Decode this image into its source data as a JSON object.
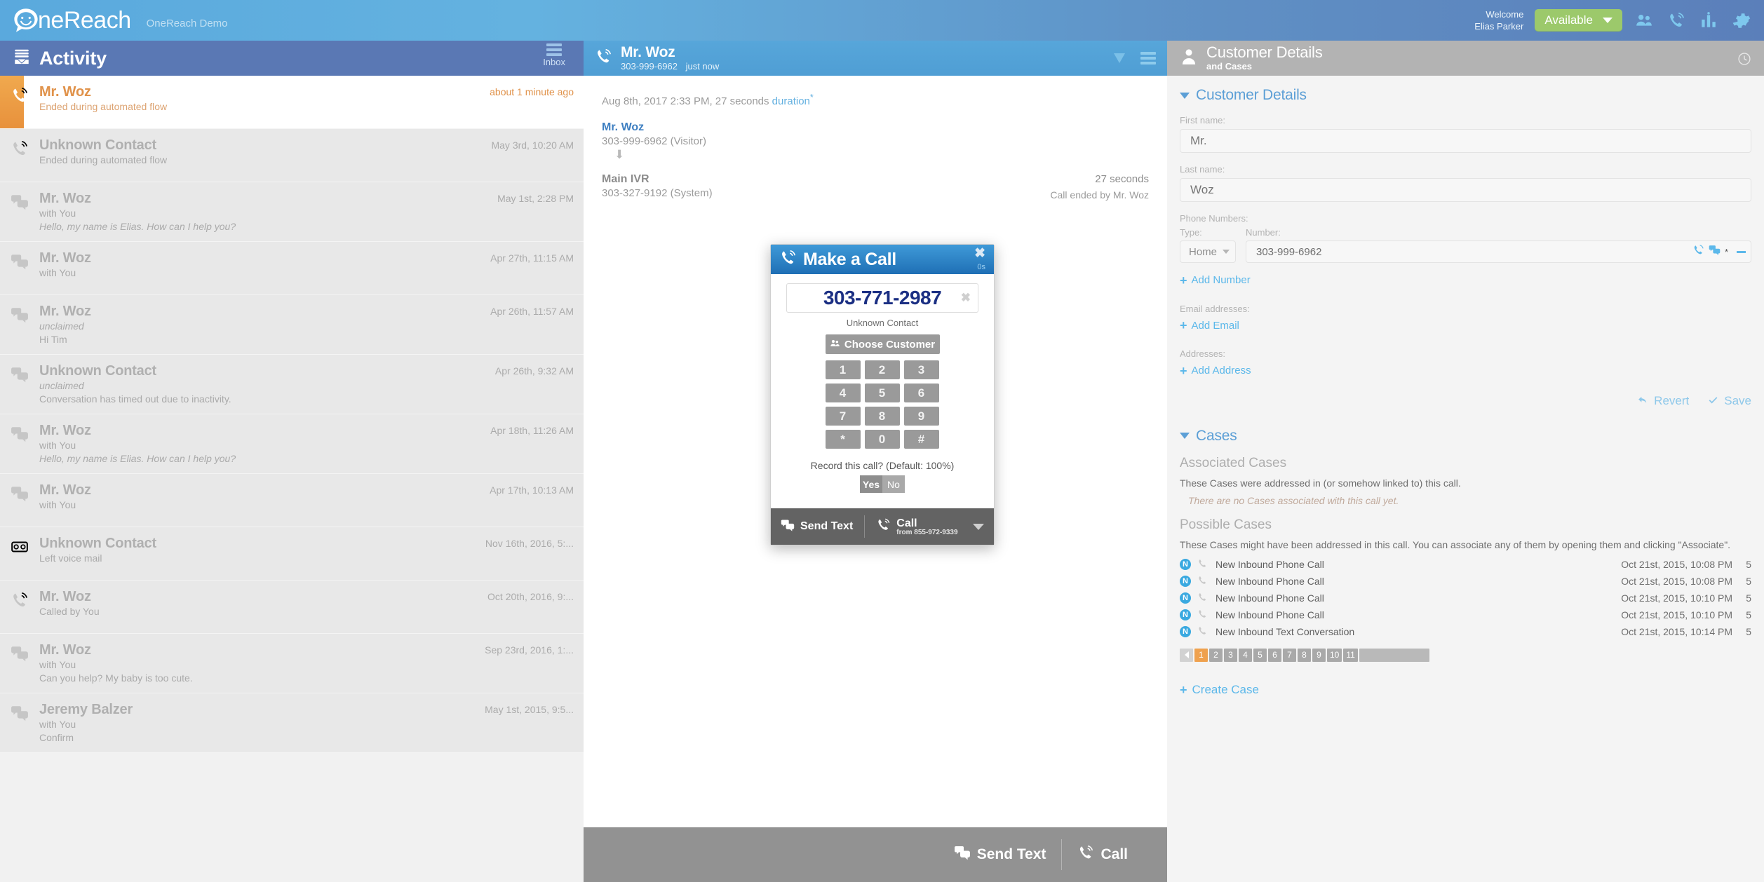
{
  "topbar": {
    "brand": "neReach",
    "demo_label": "OneReach Demo",
    "welcome_line1": "Welcome",
    "welcome_line2": "Elias Parker",
    "status": "Available",
    "icons": [
      "people-icon",
      "phone-icon",
      "chart-icon",
      "gear-icon"
    ],
    "accent": "#9cc96b"
  },
  "left": {
    "title": "Activity",
    "inbox_label": "Inbox",
    "items": [
      {
        "icon": "phone-icon",
        "name": "Mr. Woz",
        "sub1": "Ended during automated flow",
        "sub2": "",
        "time": "about 1 minute ago",
        "active": true
      },
      {
        "icon": "phone-icon",
        "name": "Unknown Contact",
        "sub1": "Ended during automated flow",
        "sub2": "",
        "time": "May 3rd, 10:20 AM",
        "active": false
      },
      {
        "icon": "chat-icon",
        "name": "Mr. Woz",
        "sub1": "with You",
        "sub2": "Hello, my name is Elias. How can I help you?",
        "time": "May 1st, 2:28 PM",
        "active": false
      },
      {
        "icon": "chat-icon",
        "name": "Mr. Woz",
        "sub1": "with You",
        "sub2": "",
        "time": "Apr 27th, 11:15 AM",
        "active": false
      },
      {
        "icon": "chat-icon",
        "name": "Mr. Woz",
        "sub1": "unclaimed",
        "sub2": "Hi Tim",
        "time": "Apr 26th, 11:57 AM",
        "active": false
      },
      {
        "icon": "chat-icon",
        "name": "Unknown Contact",
        "sub1": "unclaimed",
        "sub2": "Conversation has timed out due to inactivity.",
        "time": "Apr 26th, 9:32 AM",
        "active": false
      },
      {
        "icon": "chat-icon",
        "name": "Mr. Woz",
        "sub1": "with You",
        "sub2": "Hello, my name is Elias. How can I help you?",
        "time": "Apr 18th, 11:26 AM",
        "active": false
      },
      {
        "icon": "chat-icon",
        "name": "Mr. Woz",
        "sub1": "with You",
        "sub2": "",
        "time": "Apr 17th, 10:13 AM",
        "active": false
      },
      {
        "icon": "voicemail-icon",
        "name": "Unknown Contact",
        "sub1": "Left voice mail",
        "sub2": "",
        "time": "Nov 16th, 2016, 5:...",
        "active": false
      },
      {
        "icon": "phone-icon",
        "name": "Mr. Woz",
        "sub1": "Called by You",
        "sub2": "",
        "time": "Oct 20th, 2016, 9:...",
        "active": false
      },
      {
        "icon": "chat-icon",
        "name": "Mr. Woz",
        "sub1": "with You",
        "sub2": "Can you help? My baby is too cute.",
        "time": "Sep 23rd, 2016, 1:...",
        "active": false
      },
      {
        "icon": "chat-icon",
        "name": "Jeremy Balzer",
        "sub1": "with You",
        "sub2": "Confirm",
        "time": "May 1st, 2015, 9:5...",
        "active": false
      }
    ]
  },
  "center": {
    "header": {
      "name": "Mr. Woz",
      "phone": "303-999-6962",
      "when": "just now"
    },
    "call_meta_prefix": "Aug 8th, 2017 2:33 PM, 27 seconds ",
    "call_meta_link": "duration",
    "legs": [
      {
        "name": "Mr. Woz",
        "number": "303-999-6962 (Visitor)",
        "system": false
      },
      {
        "name": "Main IVR",
        "number": "303-327-9192 (System)",
        "system": true
      }
    ],
    "duration": "27 seconds",
    "ended_by": "Call ended by Mr. Woz",
    "footer": {
      "send_text": "Send Text",
      "call": "Call"
    }
  },
  "modal": {
    "title": "Make a Call",
    "timer": "0s",
    "number": "303-771-2987",
    "contact_label": "Unknown Contact",
    "choose_customer": "Choose Customer",
    "keys": [
      "1",
      "2",
      "3",
      "4",
      "5",
      "6",
      "7",
      "8",
      "9",
      "*",
      "0",
      "#"
    ],
    "record_question": "Record this call? (Default: 100%)",
    "yes": "Yes",
    "no": "No",
    "send_text": "Send Text",
    "call": "Call",
    "call_from": "from 855-972-9339"
  },
  "right": {
    "header_title": "Customer Details",
    "header_sub": "and Cases",
    "section_customer": "Customer Details",
    "first_name_label": "First name:",
    "first_name_value": "Mr.",
    "last_name_label": "Last name:",
    "last_name_value": "Woz",
    "phone_numbers_label": "Phone Numbers:",
    "type_label": "Type:",
    "number_label": "Number:",
    "phone_type": "Home",
    "phone_value": "303-999-6962",
    "add_number": "Add Number",
    "email_label": "Email addresses:",
    "add_email": "Add Email",
    "addresses_label": "Addresses:",
    "add_address": "Add Address",
    "revert": "Revert",
    "save": "Save",
    "section_cases": "Cases",
    "associated_title": "Associated Cases",
    "associated_desc": "These Cases were addressed in (or somehow linked to) this call.",
    "associated_empty": "There are no Cases associated with this call yet.",
    "possible_title": "Possible Cases",
    "possible_desc": "These Cases might have been addressed in this call. You can associate any of them by opening them and clicking \"Associate\".",
    "possible_cases": [
      {
        "badge": "N",
        "title": "New Inbound Phone Call",
        "time": "Oct 21st, 2015, 10:08 PM",
        "count": "5"
      },
      {
        "badge": "N",
        "title": "New Inbound Phone Call",
        "time": "Oct 21st, 2015, 10:08 PM",
        "count": "5"
      },
      {
        "badge": "N",
        "title": "New Inbound Phone Call",
        "time": "Oct 21st, 2015, 10:10 PM",
        "count": "5"
      },
      {
        "badge": "N",
        "title": "New Inbound Phone Call",
        "time": "Oct 21st, 2015, 10:10 PM",
        "count": "5"
      },
      {
        "badge": "N",
        "title": "New Inbound Text Conversation",
        "time": "Oct 21st, 2015, 10:14 PM",
        "count": "5"
      }
    ],
    "pages": [
      "1",
      "2",
      "3",
      "4",
      "5",
      "6",
      "7",
      "8",
      "9",
      "10",
      "11"
    ],
    "current_page": "1",
    "create_case": "Create Case"
  }
}
